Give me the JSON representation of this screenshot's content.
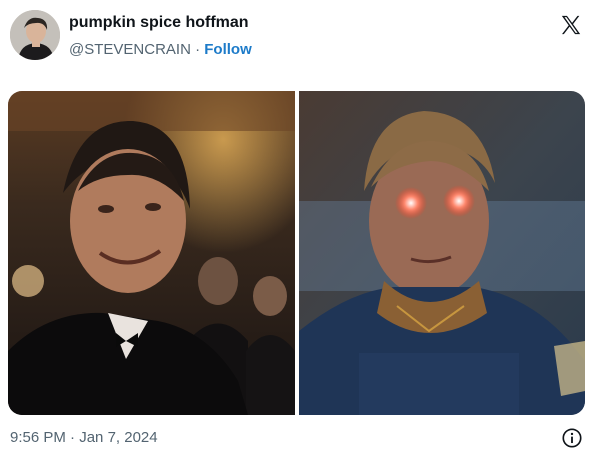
{
  "author": {
    "display_name": "pumpkin spice hoffman",
    "handle": "@STEVENCRAIN",
    "separator": "·",
    "follow_label": "Follow"
  },
  "icons": {
    "platform_logo": "x-logo-icon",
    "info": "info-icon"
  },
  "media": {
    "left_image": "man-in-tuxedo-smiling-at-event",
    "right_image": "superhero-character-glowing-red-eyes"
  },
  "footer": {
    "time": "9:56 PM",
    "separator": "·",
    "date": "Jan 7, 2024"
  },
  "colors": {
    "follow": "#1d7bc9",
    "secondary_text": "#536471",
    "primary_text": "#0f1419"
  }
}
